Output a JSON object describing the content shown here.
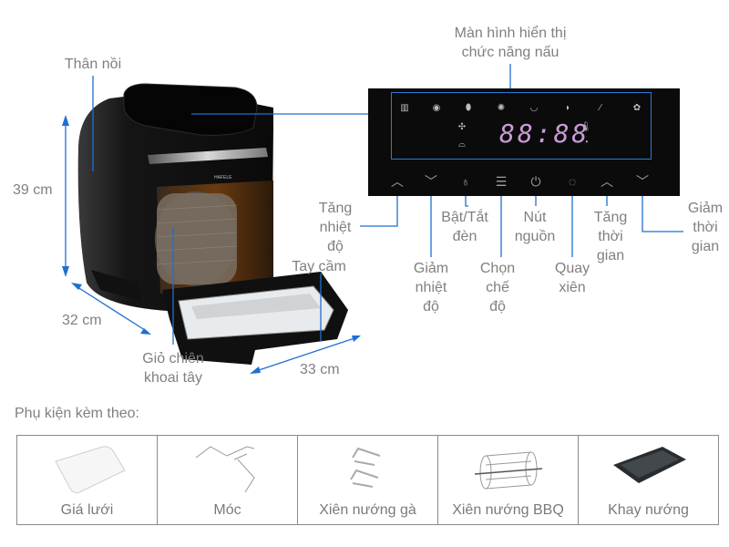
{
  "diagram": {
    "product_brand_mark": "HAFELE",
    "labels": {
      "body": "Thân nồi",
      "display": "Màn hình hiển thị\nchức năng nấu",
      "height": "39 cm",
      "depth": "32 cm",
      "width": "33 cm",
      "handle": "Tay cầm",
      "basket": "Giỏ chiên\nkhoai tây",
      "temp_up": "Tăng\nnhiệt\nđộ",
      "temp_down": "Giảm\nnhiệt\nđộ",
      "light": "Bật/Tắt\nđèn",
      "mode": "Chọn\nchế\nđộ",
      "power": "Nút\nnguồn",
      "rotisserie": "Quay\nxiên",
      "time_up": "Tăng\nthời\ngian",
      "time_down": "Giảm\nthời\ngian"
    },
    "display_readout": "88:88",
    "function_icons": [
      "fries-icon",
      "steak-icon",
      "drumstick-icon",
      "fish-icon",
      "shrimp-icon",
      "chicken-icon",
      "skewer-icon",
      "cake-icon"
    ],
    "panel_buttons": [
      "temp-up",
      "temp-down",
      "light",
      "mode",
      "power",
      "rotate",
      "time-up",
      "time-down"
    ],
    "colors": {
      "annotation_line": "#1f6fd1",
      "display_digits": "#c99ad6",
      "panel_bg": "#0b0b0b"
    }
  },
  "accessories": {
    "title": "Phụ kiện kèm theo:",
    "items": [
      {
        "name": "Giá lưới",
        "icon": "wire-rack-icon"
      },
      {
        "name": "Móc",
        "icon": "hook-icon"
      },
      {
        "name": "Xiên nướng gà",
        "icon": "chicken-skewer-icon"
      },
      {
        "name": "Xiên nướng BBQ",
        "icon": "bbq-cage-icon"
      },
      {
        "name": "Khay nướng",
        "icon": "baking-tray-icon"
      }
    ]
  }
}
